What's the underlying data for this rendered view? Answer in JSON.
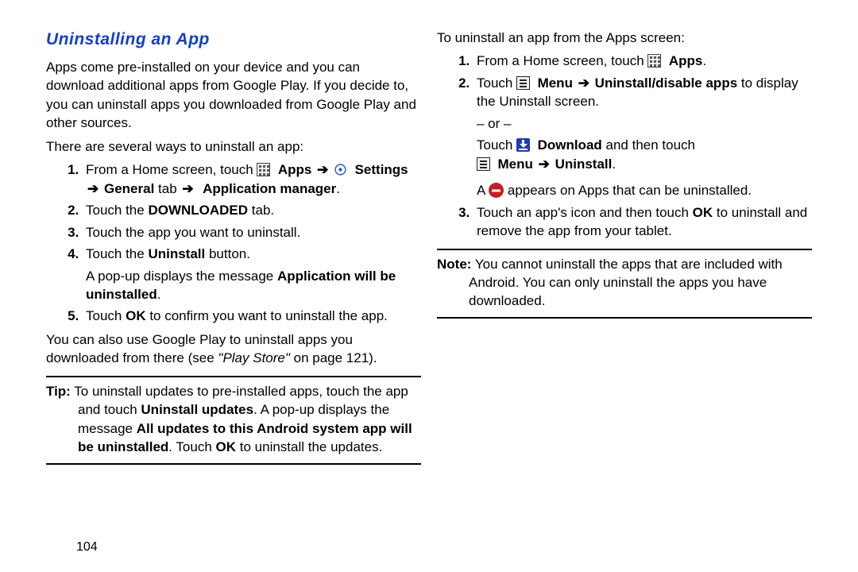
{
  "heading": "Uninstalling an App",
  "left": {
    "intro": "Apps come pre-installed on your device and you can download additional apps from Google Play. If you decide to, you can uninstall apps you downloaded from Google Play and other sources.",
    "lead": "There are several ways to uninstall an app:",
    "s1a": "From a Home screen, touch ",
    "apps": "Apps",
    "settings": "Settings",
    "general": "General",
    "tabword": " tab ",
    "appmgr": "Application manager",
    "s2a": "Touch the ",
    "downloaded": "DOWNLOADED",
    "s2b": " tab.",
    "s3": "Touch the app you want to uninstall.",
    "s4a": "Touch the ",
    "uninstallbtn": "Uninstall",
    "s4b": " button.",
    "s4c": "A pop-up displays the message ",
    "appwill": "Application will be uninstalled",
    "s5a": "Touch ",
    "ok": "OK",
    "s5b": " to confirm you want to uninstall the app.",
    "after1": "You can also use Google Play to uninstall apps you downloaded from there (see ",
    "playstore": "\"Play Store\"",
    "after2": " on page 121).",
    "tiplabel": "Tip:",
    "tip1": " To uninstall updates to pre-installed apps, touch the app and touch ",
    "uninstup": "Uninstall updates",
    "tip2": ". A pop-up displays the message ",
    "allupd": "All updates to this Android system app will be uninstalled",
    "tip3": ". Touch ",
    "tip4": " to uninstall the updates."
  },
  "right": {
    "lead": "To uninstall an app from the Apps screen:",
    "s1a": "From a Home screen, touch ",
    "apps": "Apps",
    "s2a": "Touch ",
    "menu": "Menu",
    "uninstdisable": "Uninstall/disable apps",
    "s2b": " to display the Uninstall screen.",
    "or": "– or –",
    "s2c": "Touch ",
    "download": "Download",
    "s2d": " and then touch",
    "uninstall": "Uninstall",
    "s2e": "A ",
    "s2f": " appears on Apps that can be uninstalled.",
    "s3a": "Touch an app's icon and then touch ",
    "ok": "OK",
    "s3b": " to uninstall and remove the app from your tablet.",
    "notelabel": "Note:",
    "note": " You cannot uninstall the apps that are included with Android. You can only uninstall the apps you have downloaded."
  },
  "arrow": "➔",
  "period": ".",
  "pagenum": "104"
}
